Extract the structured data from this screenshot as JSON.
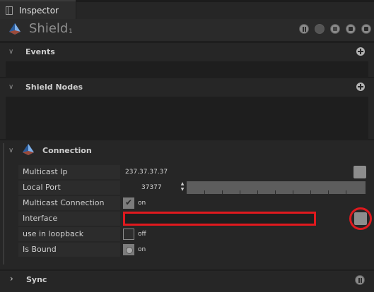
{
  "tab": {
    "label": "Inspector"
  },
  "title": {
    "name": "Shield",
    "sub": "1"
  },
  "sections": {
    "events": {
      "label": "Events"
    },
    "nodes": {
      "label": "Shield Nodes"
    },
    "connection": {
      "label": "Connection"
    },
    "sync": {
      "label": "Sync"
    }
  },
  "connection": {
    "multicast_ip": {
      "label": "Multicast Ip",
      "value": "237.37.37.37"
    },
    "local_port": {
      "label": "Local Port",
      "value": "37377"
    },
    "multicast_connection": {
      "label": "Multicast Connection",
      "checked": true,
      "value_text": "on"
    },
    "interface": {
      "label": "Interface",
      "value": ""
    },
    "loopback": {
      "label": "use in loopback",
      "checked": false,
      "value_text": "off"
    },
    "is_bound": {
      "label": "Is Bound",
      "value_text": "on"
    }
  },
  "colors": {
    "highlight": "#e0191e",
    "accent": "#3a7fd0"
  }
}
